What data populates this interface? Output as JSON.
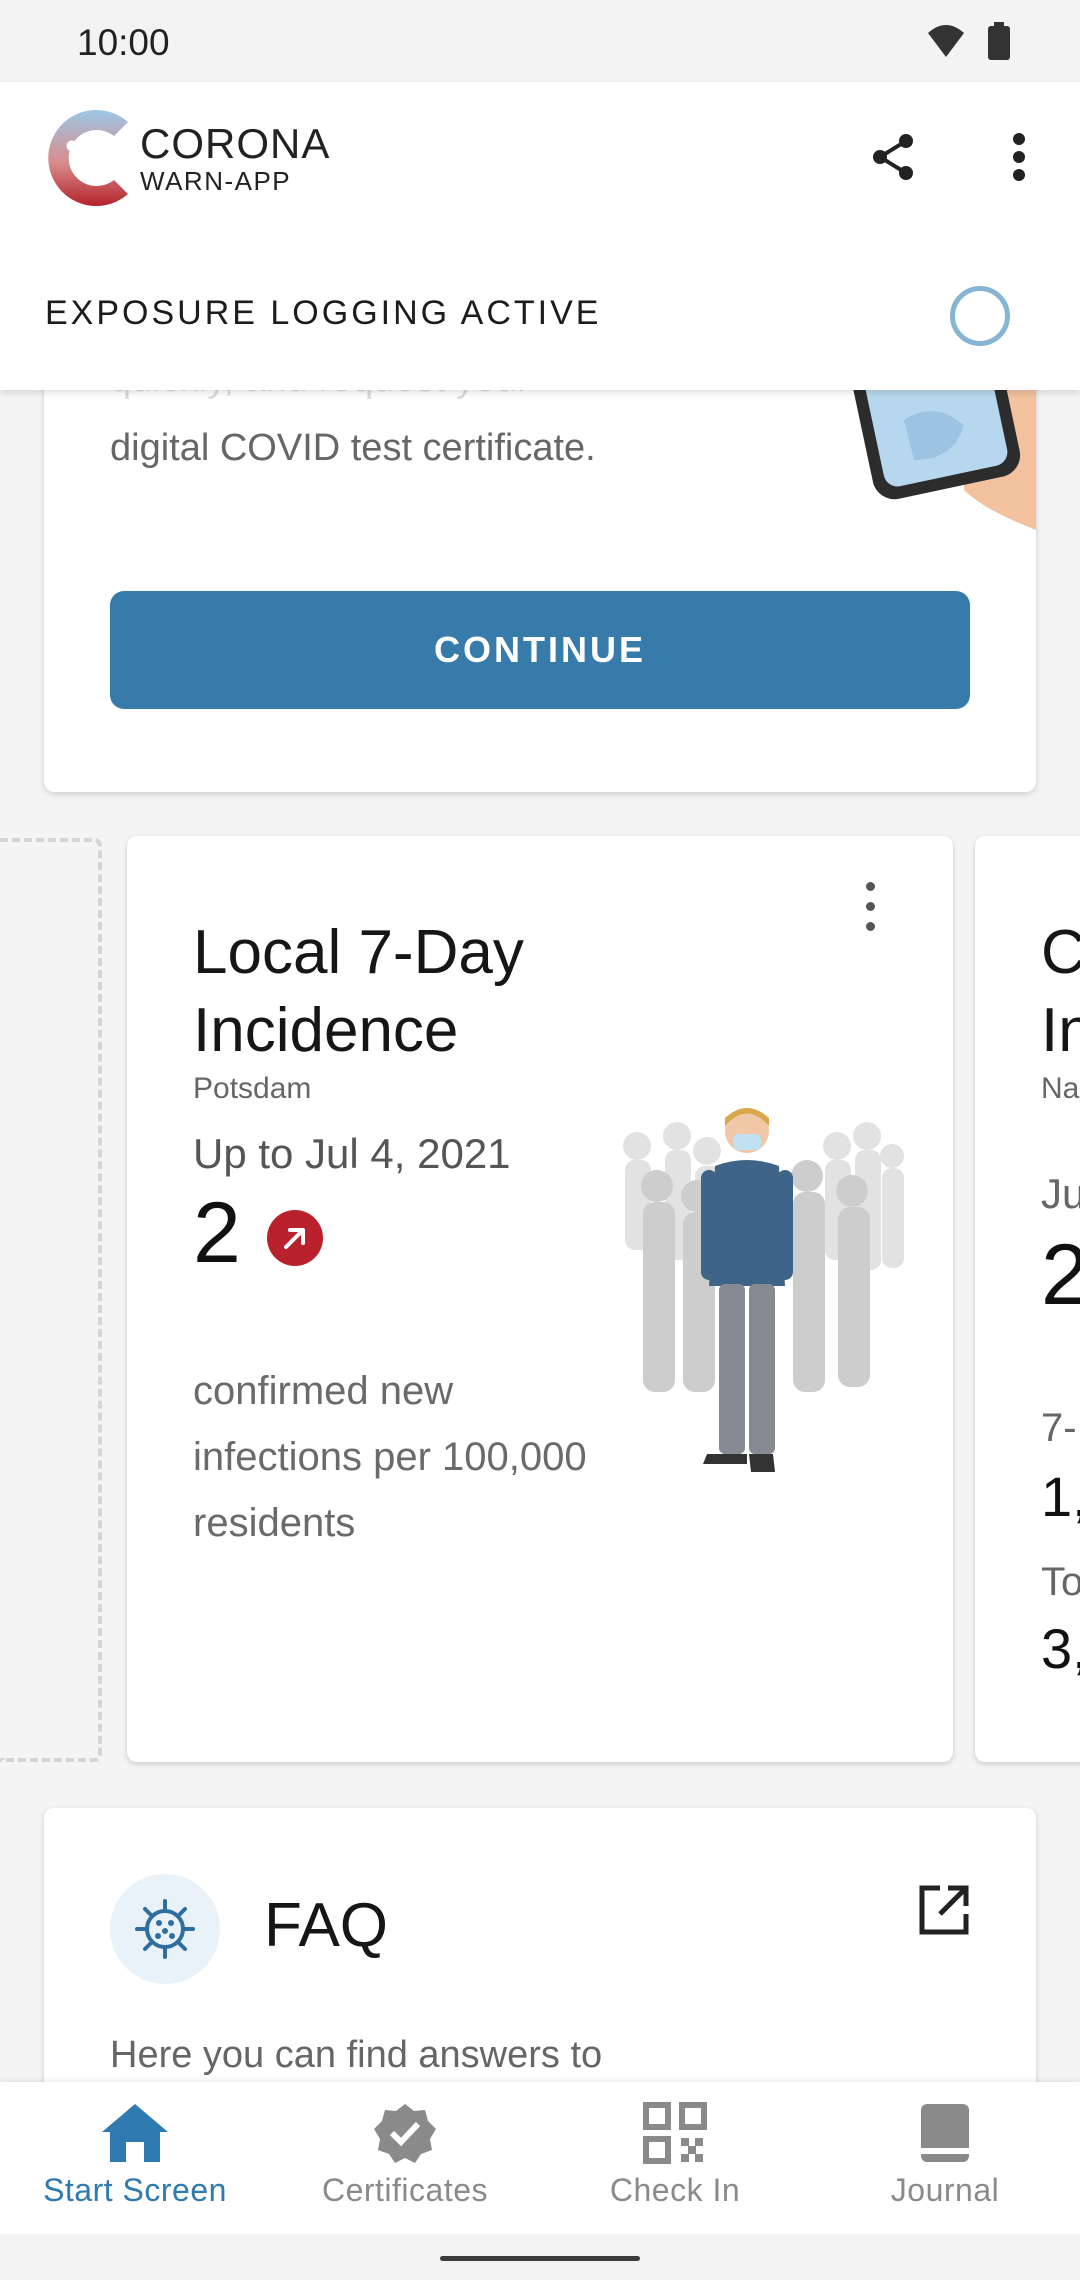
{
  "status_bar": {
    "time": "10:00"
  },
  "header": {
    "brand_line1": "CORONA",
    "brand_line2": "WARN-APP",
    "exposure_status": "EXPOSURE LOGGING ACTIVE"
  },
  "test_card": {
    "faded_text": "quickly, and request your",
    "text": "digital COVID test certificate.",
    "button_label": "CONTINUE"
  },
  "incidence_card": {
    "title": "Local 7-Day Incidence",
    "location": "Potsdam",
    "date": "Up to Jul 4, 2021",
    "value": "2",
    "trend": "increasing",
    "description": "confirmed new infections per 100,000 residents"
  },
  "peek_card": {
    "title_line1": "C",
    "title_line2": "In",
    "sub": "Na",
    "line1": "Ju",
    "line2": "2",
    "line3": "7-",
    "line4": "1,",
    "line5": "To",
    "line6": "3,"
  },
  "faq_card": {
    "title": "FAQ",
    "text": "Here you can find answers to"
  },
  "bottom_nav": {
    "items": [
      {
        "label": "Start Screen",
        "icon": "home-icon",
        "active": true
      },
      {
        "label": "Certificates",
        "icon": "certificate-icon",
        "active": false
      },
      {
        "label": "Check In",
        "icon": "qr-code-icon",
        "active": false
      },
      {
        "label": "Journal",
        "icon": "book-icon",
        "active": false
      }
    ]
  },
  "colors": {
    "primary_blue": "#367ba9",
    "nav_active": "#2f7ab0",
    "trend_red": "#b9212c",
    "status_ring": "#86b5d3"
  }
}
